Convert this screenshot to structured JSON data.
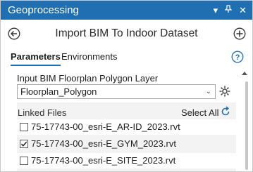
{
  "panel": {
    "title": "Geoprocessing",
    "icons": [
      "chevron-down-icon",
      "pin-icon",
      "close-icon"
    ]
  },
  "tool": {
    "title": "Import BIM To Indoor Dataset"
  },
  "tabs": [
    {
      "label": "Parameters",
      "active": true
    },
    {
      "label": "Environments",
      "active": false
    }
  ],
  "params": {
    "floorplan_label": "Input BIM Floorplan Polygon Layer",
    "floorplan_value": "Floorplan_Polygon",
    "linked_files_label": "Linked Files",
    "select_all_label": "Select All",
    "files": [
      {
        "name": "75-17743-00_esri-E_AR-ID_2023.rvt",
        "checked": false
      },
      {
        "name": "75-17743-00_esri-E_GYM_2023.rvt",
        "checked": true
      },
      {
        "name": "75-17743-00_esri-E_SITE_2023.rvt",
        "checked": false
      }
    ]
  },
  "colors": {
    "titlebar": "#1f6fb2",
    "accent": "#1f6fb2"
  }
}
